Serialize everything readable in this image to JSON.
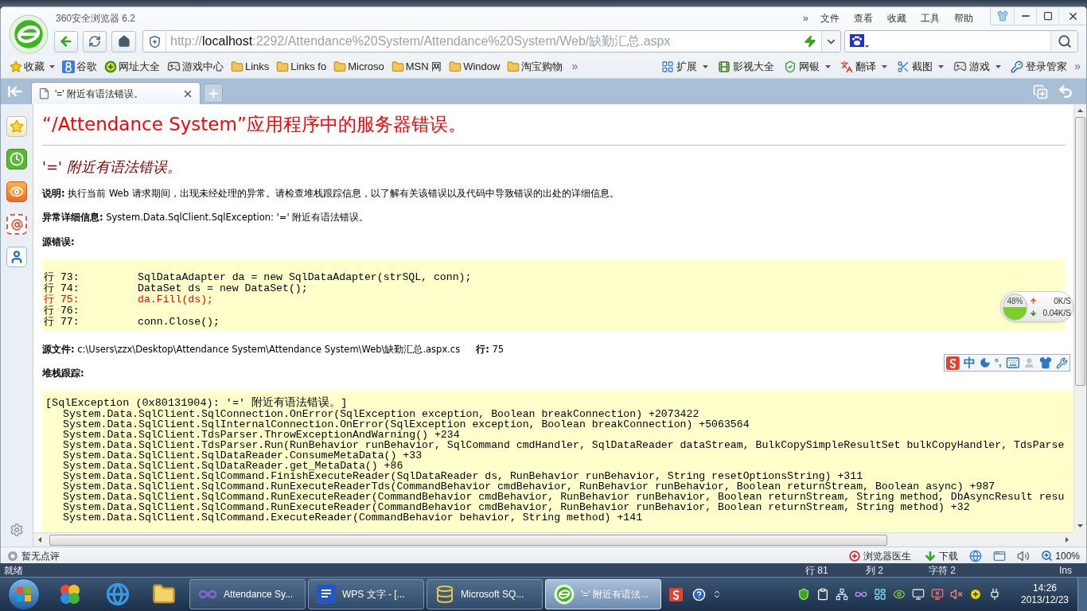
{
  "browser": {
    "title": "360安全浏览器 6.2",
    "menu_more": "»",
    "menu": [
      "文件",
      "查看",
      "收藏",
      "工具",
      "帮助"
    ],
    "address": {
      "scheme": "http://",
      "host": "localhost",
      "path": ":2292/Attendance%20System/Attendance%20System/Web/缺勤汇总.aspx"
    },
    "bookmarks": [
      {
        "label": "收藏",
        "kind": "favorites",
        "menu": true
      },
      {
        "label": "谷歌",
        "kind": "site",
        "menu": false
      },
      {
        "label": "网址大全",
        "kind": "site",
        "menu": false
      },
      {
        "label": "游戏中心",
        "kind": "site",
        "menu": false
      },
      {
        "label": "Links",
        "kind": "folder",
        "menu": false
      },
      {
        "label": "Links fo",
        "kind": "folder",
        "menu": false
      },
      {
        "label": "Microso",
        "kind": "folder",
        "menu": false
      },
      {
        "label": "MSN 网",
        "kind": "folder",
        "menu": false
      },
      {
        "label": "Window",
        "kind": "folder",
        "menu": false
      },
      {
        "label": "淘宝购物",
        "kind": "folder",
        "menu": false
      }
    ],
    "bookmarks_more": "»",
    "tools": [
      {
        "label": "扩展",
        "menu": true
      },
      {
        "label": "影视大全",
        "menu": false
      },
      {
        "label": "网银",
        "menu": true
      },
      {
        "label": "翻译",
        "menu": true
      },
      {
        "label": "截图",
        "menu": true
      },
      {
        "label": "游戏",
        "menu": true
      },
      {
        "label": "登录管家",
        "menu": false
      }
    ],
    "tools_more": "»",
    "tabs": [
      {
        "label": "'=' 附近有语法错误。",
        "selected": true
      }
    ]
  },
  "page": {
    "heading": "“/Attendance System”应用程序中的服务器错误。",
    "error_title": "'=' 附近有语法错误。",
    "description": "**说明:** 执行当前 Web 请求期间，出现未经处理的异常。请检查堆栈跟踪信息，以了解有关该错误以及代码中导致错误的出处的详细信息。",
    "exception_details": "**异常详细信息:** System.Data.SqlClient.SqlException: '=' 附近有语法错误。",
    "source_error_label": "源错误:",
    "source_lines": [
      {
        "number": "行 73:",
        "code": "SqlDataAdapter da = new SqlDataAdapter(strSQL, conn);",
        "error": false
      },
      {
        "number": "行 74:",
        "code": "DataSet ds = new DataSet();",
        "error": false
      },
      {
        "number": "行 75:",
        "code": "da.Fill(ds);",
        "error": true
      },
      {
        "number": "行 76:",
        "error": false
      },
      {
        "number": "行 77:",
        "code": "conn.Close();",
        "error": false
      }
    ],
    "source_file": "**源文件:** c:\\Users\\zzx\\Desktop\\Attendance System\\Attendance System\\Web\\缺勤汇总.aspx.cs",
    "source_line": "**行:** 75",
    "stack_trace_label": "堆栈跟踪:",
    "stack_trace": {
      "exception": "[SqlException (0x80131904): '=' 附近有语法错误。]",
      "frames": [
        "System.Data.SqlClient.SqlConnection.OnError(SqlException exception, Boolean breakConnection) +2073422",
        "System.Data.SqlClient.SqlInternalConnection.OnError(SqlException exception, Boolean breakConnection) +5063564",
        "System.Data.SqlClient.TdsParser.ThrowExceptionAndWarning() +234",
        "System.Data.SqlClient.TdsParser.Run(RunBehavior runBehavior, SqlCommand cmdHandler, SqlDataReader dataStream, BulkCopySimpleResultSet bulkCopyHandler, TdsParse",
        "System.Data.SqlClient.SqlDataReader.ConsumeMetaData() +33",
        "System.Data.SqlClient.SqlDataReader.get_MetaData() +86",
        "System.Data.SqlClient.SqlCommand.FinishExecuteReader(SqlDataReader ds, RunBehavior runBehavior, String resetOptionsString) +311",
        "System.Data.SqlClient.SqlCommand.RunExecuteReaderTds(CommandBehavior cmdBehavior, RunBehavior runBehavior, Boolean returnStream, Boolean async) +987",
        "System.Data.SqlClient.SqlCommand.RunExecuteReader(CommandBehavior cmdBehavior, RunBehavior runBehavior, Boolean returnStream, String method, DbAsyncResult resu",
        "System.Data.SqlClient.SqlCommand.RunExecuteReader(CommandBehavior cmdBehavior, RunBehavior runBehavior, Boolean returnStream, String method) +32",
        "System.Data.SqlClient.SqlCommand.ExecuteReader(CommandBehavior behavior, String method) +141"
      ]
    }
  },
  "speed_meter": {
    "level": 0.48,
    "percent": "48%",
    "upload": "0K/S",
    "download": "0.04K/S"
  },
  "ime_toolbar": {
    "mode": "中",
    "punctuation": "°,"
  },
  "status_bar": {
    "rating": "暂无点评",
    "doctor": "浏览器医生",
    "download": "下载",
    "zoom": "100%"
  },
  "editor_status": {
    "state": "就绪",
    "line": "行 81",
    "column": "列 2",
    "char": "字符 2",
    "mode": "Ins"
  },
  "taskbar": {
    "tasks": [
      {
        "label": "Attendance Sy...",
        "selected": false
      },
      {
        "label": "WPS 文字 - [...",
        "selected": false
      },
      {
        "label": "Microsoft SQ...",
        "selected": false
      },
      {
        "label": "'=' 附近有语法...",
        "selected": true
      }
    ],
    "time": "14:26",
    "date": "2013/12/23"
  }
}
